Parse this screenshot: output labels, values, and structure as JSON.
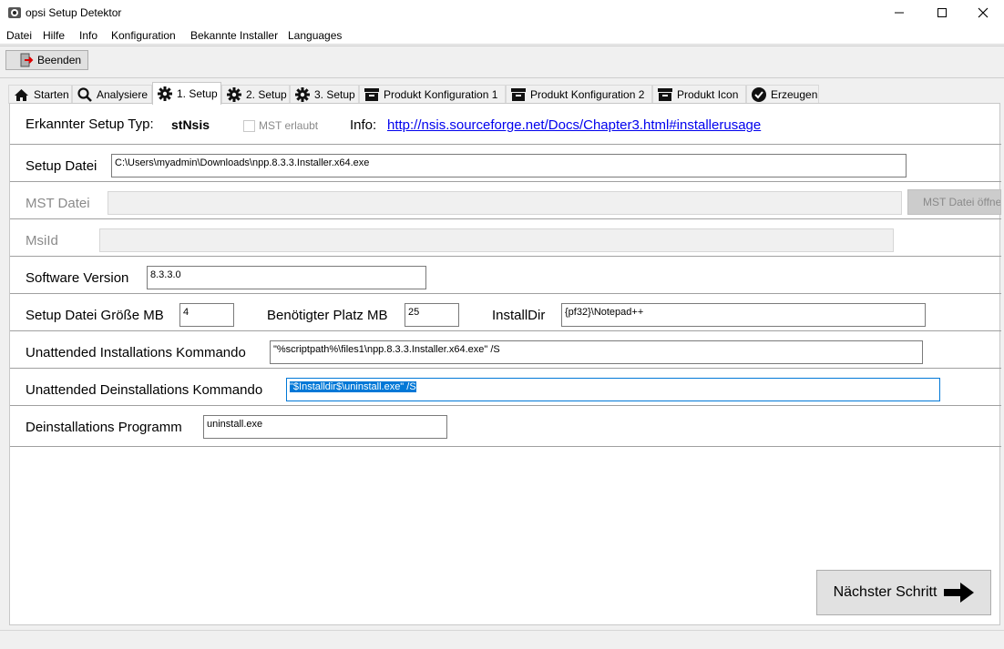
{
  "window": {
    "title": "opsi Setup Detektor"
  },
  "menu": [
    "Datei",
    "Hilfe",
    "Info",
    "Konfiguration",
    "Bekannte Installer",
    "Languages"
  ],
  "toolbar": {
    "quit_label": "Beenden"
  },
  "tabs": [
    {
      "label": "Starten",
      "icon": "home-icon"
    },
    {
      "label": "Analysiere",
      "icon": "search-icon"
    },
    {
      "label": "1. Setup",
      "icon": "gear-icon",
      "active": true
    },
    {
      "label": "2. Setup",
      "icon": "gear-icon"
    },
    {
      "label": "3. Setup",
      "icon": "gear-icon"
    },
    {
      "label": "Produkt Konfiguration 1",
      "icon": "box-icon"
    },
    {
      "label": "Produkt Konfiguration 2",
      "icon": "box-icon"
    },
    {
      "label": "Produkt Icon",
      "icon": "box-icon"
    },
    {
      "label": "Erzeugen",
      "icon": "check-circle-icon"
    }
  ],
  "setup": {
    "detected_type_label": "Erkannter Setup Typ:",
    "detected_type_value": "stNsis",
    "mst_allowed_label": "MST erlaubt",
    "mst_allowed_checked": false,
    "info_label": "Info:",
    "info_link": "http://nsis.sourceforge.net/Docs/Chapter3.html#installerusage",
    "setup_file_label": "Setup Datei",
    "setup_file_value": "C:\\Users\\myadmin\\Downloads\\npp.8.3.3.Installer.x64.exe",
    "mst_file_label": "MST Datei",
    "mst_file_value": "",
    "mst_button_label": "MST Datei öffnen",
    "msiid_label": "MsiId",
    "msiid_value": "",
    "software_version_label": "Software Version",
    "software_version_value": "8.3.3.0",
    "setup_size_label": "Setup Datei Größe MB",
    "setup_size_value": "4",
    "required_space_label": "Benötigter Platz MB",
    "required_space_value": "25",
    "installdir_label": "InstallDir",
    "installdir_value": "{pf32}\\Notepad++",
    "install_cmd_label": "Unattended Installations Kommando",
    "install_cmd_value": "\"%scriptpath%\\files1\\npp.8.3.3.Installer.x64.exe\" /S",
    "uninstall_cmd_label": "Unattended Deinstallations Kommando",
    "uninstall_cmd_value": "\"$Installdir$\\uninstall.exe\" /S",
    "uninstall_prog_label": "Deinstallations Programm",
    "uninstall_prog_value": "uninstall.exe",
    "next_button_label": "Nächster Schritt"
  },
  "colors": {
    "link": "#0000ee",
    "selection": "#0078d7"
  }
}
